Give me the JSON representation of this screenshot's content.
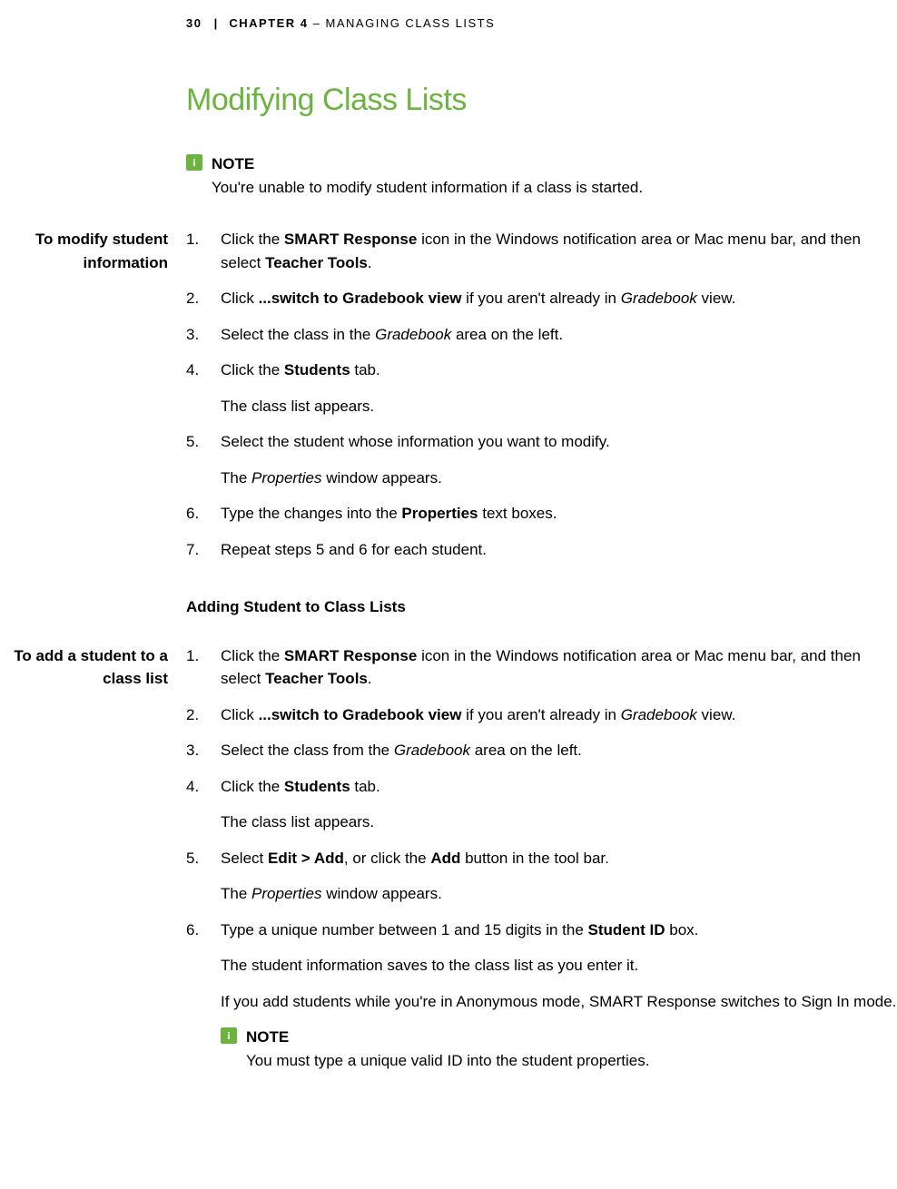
{
  "header": {
    "page_number": "30",
    "separator": "|",
    "chapter": "CHAPTER 4",
    "dash": "–",
    "chapter_title": "MANAGING CLASS LISTS"
  },
  "title": "Modifying Class Lists",
  "note1": {
    "label": "NOTE",
    "text": "You're unable to modify student information if a class is started."
  },
  "section1": {
    "sidelabel": "To modify student information",
    "steps": [
      {
        "parts": [
          {
            "t": "Click the "
          },
          {
            "t": "SMART Response",
            "b": true
          },
          {
            "t": " icon in the Windows notification area or Mac menu bar, and then select "
          },
          {
            "t": "Teacher Tools",
            "b": true
          },
          {
            "t": "."
          }
        ]
      },
      {
        "parts": [
          {
            "t": "Click "
          },
          {
            "t": "...switch to Gradebook view",
            "b": true
          },
          {
            "t": " if you aren't already in "
          },
          {
            "t": "Gradebook",
            "i": true
          },
          {
            "t": " view."
          }
        ]
      },
      {
        "parts": [
          {
            "t": "Select the class in the "
          },
          {
            "t": "Gradebook",
            "i": true
          },
          {
            "t": " area on the left."
          }
        ]
      },
      {
        "parts": [
          {
            "t": "Click the "
          },
          {
            "t": "Students",
            "b": true
          },
          {
            "t": " tab."
          }
        ],
        "sub": "The class list appears."
      },
      {
        "parts": [
          {
            "t": "Select the student whose information you want to modify."
          }
        ],
        "sub_parts": [
          {
            "t": "The "
          },
          {
            "t": "Properties",
            "i": true
          },
          {
            "t": " window appears."
          }
        ]
      },
      {
        "parts": [
          {
            "t": "Type the changes into the "
          },
          {
            "t": "Properties",
            "b": true
          },
          {
            "t": " text boxes."
          }
        ]
      },
      {
        "parts": [
          {
            "t": "Repeat steps 5 and 6 for each student."
          }
        ]
      }
    ]
  },
  "subheading": "Adding Student to Class Lists",
  "section2": {
    "sidelabel": "To add a student to a class list",
    "steps": [
      {
        "parts": [
          {
            "t": "Click the "
          },
          {
            "t": "SMART Response",
            "b": true
          },
          {
            "t": " icon in the Windows notification area or Mac menu bar, and then select "
          },
          {
            "t": "Teacher Tools",
            "b": true
          },
          {
            "t": "."
          }
        ]
      },
      {
        "parts": [
          {
            "t": "Click "
          },
          {
            "t": "...switch to Gradebook view",
            "b": true
          },
          {
            "t": " if you aren't already in "
          },
          {
            "t": "Gradebook",
            "i": true
          },
          {
            "t": " view."
          }
        ]
      },
      {
        "parts": [
          {
            "t": "Select the class from the "
          },
          {
            "t": "Gradebook",
            "i": true
          },
          {
            "t": " area on the left."
          }
        ]
      },
      {
        "parts": [
          {
            "t": "Click the "
          },
          {
            "t": "Students",
            "b": true
          },
          {
            "t": " tab."
          }
        ],
        "sub": "The class list appears."
      },
      {
        "parts": [
          {
            "t": "Select "
          },
          {
            "t": "Edit > Add",
            "b": true
          },
          {
            "t": ", or click the "
          },
          {
            "t": "Add",
            "b": true
          },
          {
            "t": " button in the tool bar."
          }
        ],
        "sub_parts": [
          {
            "t": "The "
          },
          {
            "t": "Properties",
            "i": true
          },
          {
            "t": " window appears."
          }
        ]
      },
      {
        "parts": [
          {
            "t": "Type a unique number between 1 and 15 digits in the "
          },
          {
            "t": "Student ID",
            "b": true
          },
          {
            "t": " box."
          }
        ],
        "sub": "The student information saves to the class list as you enter it.",
        "sub2": "If you add students while you're in Anonymous mode, SMART Response switches to Sign In mode.",
        "note": {
          "label": "NOTE",
          "text": "You must type a unique valid ID into the student properties."
        }
      }
    ]
  }
}
